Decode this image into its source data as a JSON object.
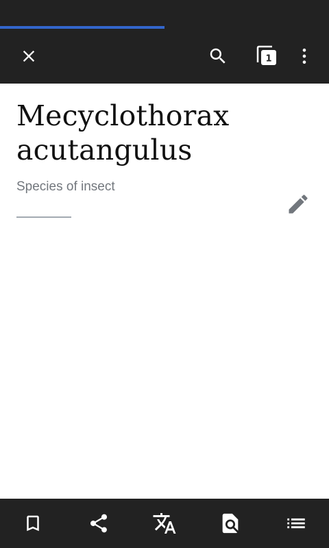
{
  "page": {
    "title": "Mecyclothorax acutangulus",
    "description": "Species of insect"
  },
  "loading": {
    "progress_percent": 50
  },
  "toolbar": {
    "tabs_count": "1",
    "icons": [
      "close-icon",
      "search-icon",
      "tabs-icon",
      "overflow-menu-icon"
    ]
  },
  "bottom_bar": {
    "icons": [
      "bookmark-icon",
      "share-icon",
      "translate-icon",
      "find-in-page-icon",
      "table-of-contents-icon"
    ]
  },
  "colors": {
    "toolbar_bg": "#222222",
    "progress": "#3366cc",
    "title_text": "#111111",
    "description_text": "#72777d",
    "icon_dark": "#72777d",
    "icon_light": "#ffffff"
  }
}
